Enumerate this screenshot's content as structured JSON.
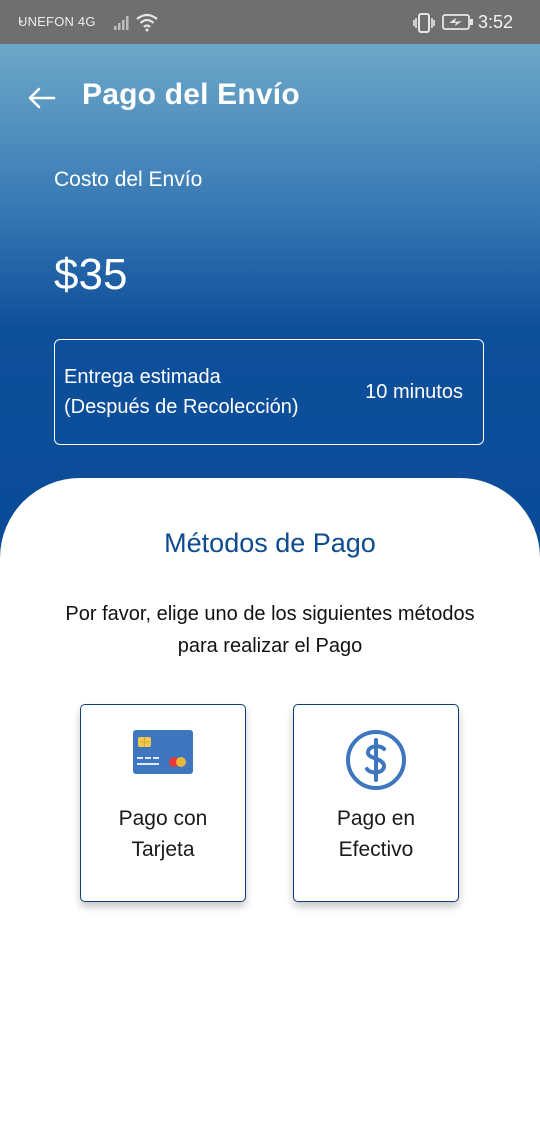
{
  "status_bar": {
    "carrier": "UNEFON 4G",
    "time": "3:52",
    "icons": [
      "signal-icon",
      "wifi-icon",
      "vibrate-icon",
      "battery-charging-icon"
    ]
  },
  "header": {
    "title": "Pago del Envío",
    "back_icon": "arrow-left-icon"
  },
  "shipping": {
    "cost_label": "Costo del Envío",
    "cost_value": "$35",
    "eta_label_line1": "Entrega estimada",
    "eta_label_line2": "(Después de Recolección)",
    "eta_value": "10 minutos"
  },
  "payment": {
    "title": "Métodos de Pago",
    "instructions_line1": "Por favor, elige uno de los siguientes métodos",
    "instructions_line2": "para realizar el Pago",
    "methods": [
      {
        "icon": "credit-card-icon",
        "label_line1": "Pago con",
        "label_line2": "Tarjeta"
      },
      {
        "icon": "cash-dollar-icon",
        "label_line1": "Pago en",
        "label_line2": "Efectivo"
      }
    ]
  },
  "colors": {
    "status_bar": "#6f6f6f",
    "header_top": "#6da8c8",
    "header_bottom": "#0a4b98",
    "accent_blue": "#0d4b8f",
    "card_icon_blue": "#3f76c0"
  }
}
